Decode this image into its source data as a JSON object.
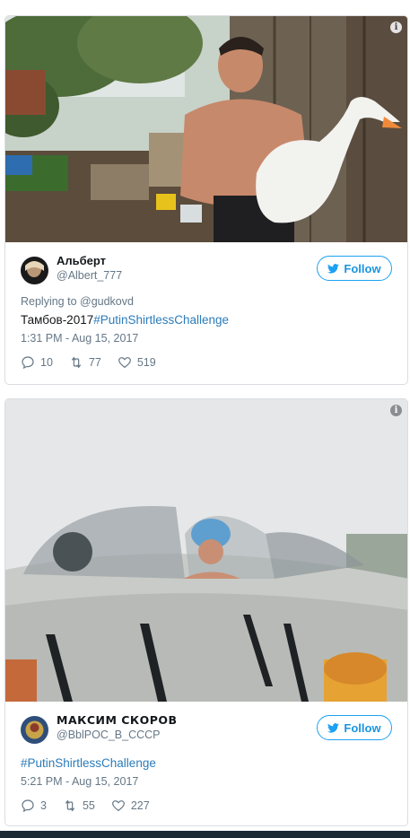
{
  "tweets": [
    {
      "author": {
        "name": "Альберт",
        "handle": "@Albert_777"
      },
      "follow_label": "Follow",
      "replying_to": "Replying to @gudkovd",
      "text_prefix": "Тамбов-2017",
      "hashtag": "#PutinShirtlessChallenge",
      "timestamp": "1:31 PM - Aug 15, 2017",
      "stats": {
        "replies": "10",
        "retweets": "77",
        "likes": "519"
      },
      "info_icon": "i"
    },
    {
      "author": {
        "name": "МАКСИМ СКОРОВ",
        "handle": "@BblPOC_B_CCCP"
      },
      "follow_label": "Follow",
      "hashtag": "#PutinShirtlessChallenge",
      "timestamp": "5:21 PM - Aug 15, 2017",
      "stats": {
        "replies": "3",
        "retweets": "55",
        "likes": "227"
      },
      "info_icon": "i"
    }
  ],
  "colors": {
    "accent": "#1da1f2",
    "link": "#2b7bb9",
    "muted": "#657786"
  },
  "icons": [
    "info-icon",
    "twitter-bird-icon",
    "reply-icon",
    "retweet-icon",
    "like-icon"
  ]
}
